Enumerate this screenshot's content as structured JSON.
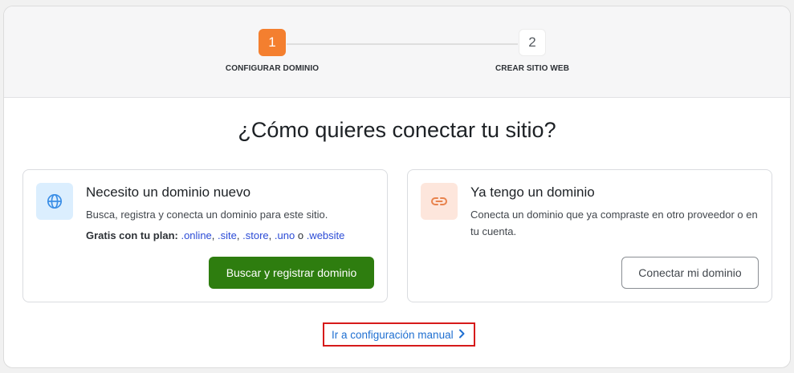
{
  "stepper": {
    "steps": [
      {
        "number": "1",
        "label": "CONFIGURAR DOMINIO",
        "state": "active"
      },
      {
        "number": "2",
        "label": "CREAR SITIO WEB",
        "state": "inactive"
      }
    ]
  },
  "main": {
    "title": "¿Cómo quieres conectar tu sitio?"
  },
  "cards": {
    "new_domain": {
      "icon": "globe-icon",
      "title": "Necesito un dominio nuevo",
      "description": "Busca, registra y conecta un dominio para este sitio.",
      "plan_label": "Gratis con tu plan:",
      "extensions": [
        ".online",
        ".site",
        ".store",
        ".uno",
        ".website"
      ],
      "separator_comma": ",",
      "separator_or": "o",
      "button_label": "Buscar y registrar dominio"
    },
    "existing_domain": {
      "icon": "link-icon",
      "title": "Ya tengo un dominio",
      "description": "Conecta un dominio que ya compraste en otro proveedor o en tu cuenta.",
      "button_label": "Conectar mi dominio"
    }
  },
  "manual_link": {
    "label": "Ir a configuración manual",
    "icon": "chevron-right-icon"
  },
  "colors": {
    "accent_orange": "#f47f2f",
    "primary_green": "#2e7d0f",
    "link_blue": "#1f6fd1",
    "highlight_red": "#d61a1a"
  }
}
